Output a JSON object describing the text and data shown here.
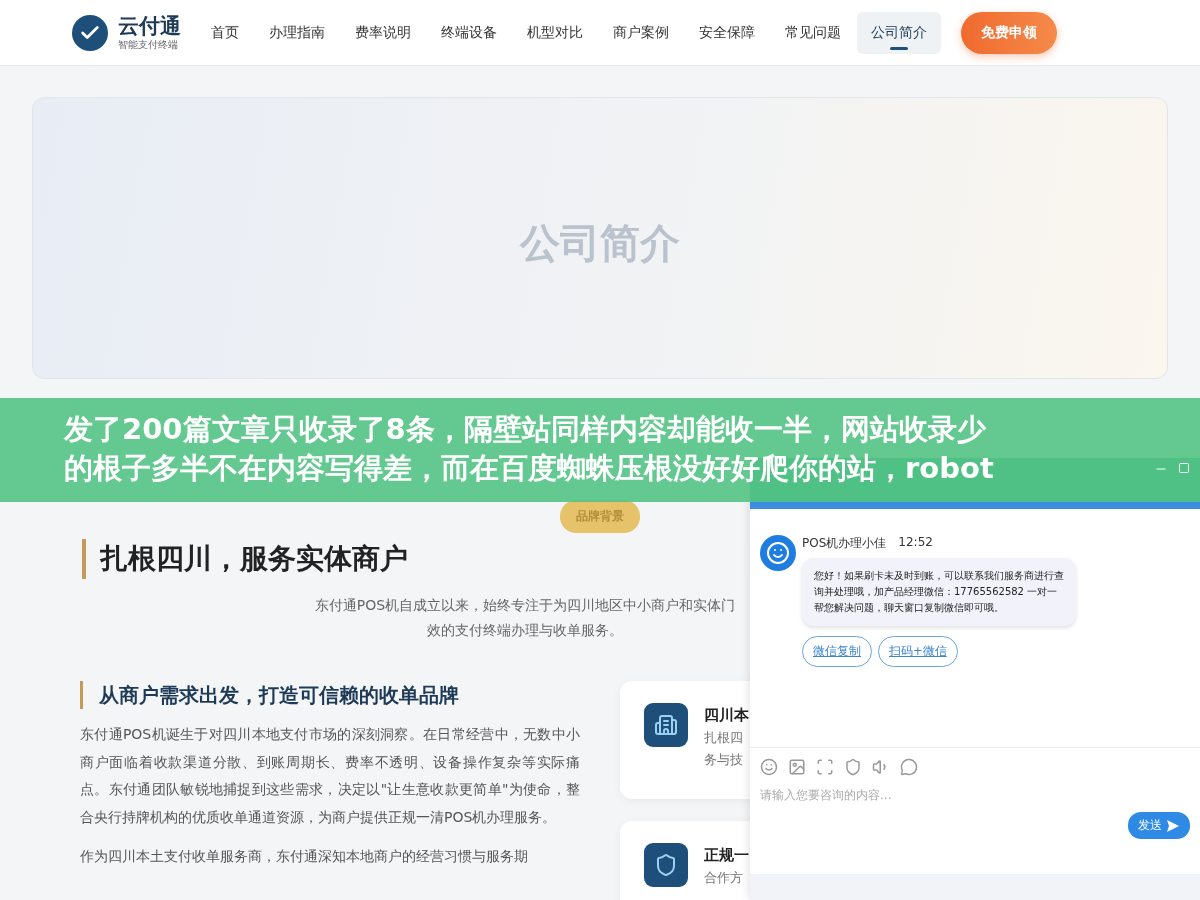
{
  "header": {
    "logo": {
      "name": "云付通",
      "tagline": "智能支付终端"
    },
    "nav": [
      {
        "label": "首页",
        "selected": false
      },
      {
        "label": "办理指南",
        "selected": false
      },
      {
        "label": "费率说明",
        "selected": false
      },
      {
        "label": "终端设备",
        "selected": false
      },
      {
        "label": "机型对比",
        "selected": false
      },
      {
        "label": "商户案例",
        "selected": false
      },
      {
        "label": "安全保障",
        "selected": false
      },
      {
        "label": "常见问题",
        "selected": false
      },
      {
        "label": "公司简介",
        "selected": true
      }
    ],
    "cta": "免费申领"
  },
  "hero": {
    "title": "公司简介"
  },
  "banner": {
    "lines": [
      "发了200篇文章只收录了8条，隔壁站同样内容却能收一半，网站收录少",
      "的根子多半不在内容写得差，而在百度蜘蛛压根没好好爬你的站，robot"
    ]
  },
  "section": {
    "badge": "品牌背景",
    "heading": "扎根四川，服务实体商户",
    "intro": [
      "东付通POS机自成立以来，始终专注于为四川地区中小商户和实体门",
      "效的支付终端办理与收单服务。"
    ],
    "subheading": "从商户需求出发，打造可信赖的收单品牌",
    "paragraphs": [
      "东付通POS机诞生于对四川本地支付市场的深刻洞察。在日常经营中，无数中小商户面临着收款渠道分散、到账周期长、费率不透明、设备操作复杂等实际痛点。东付通团队敏锐地捕捉到这些需求，决定以\"让生意收款更简单\"为使命，整合央行持牌机构的优质收单通道资源，为商户提供正规一清POS机办理服务。",
      "作为四川本土支付收单服务商，东付通深知本地商户的经营习惯与服务期"
    ],
    "cards": [
      {
        "kind": "building",
        "title": "四川本",
        "lines": [
          "扎根四",
          "务与技"
        ]
      },
      {
        "kind": "shield",
        "title": "正规一",
        "lines": [
          "合作方"
        ]
      }
    ]
  },
  "chat": {
    "agent": "POS机办理小佳",
    "time": "12:52",
    "message": "您好！如果刷卡未及时到账，可以联系我们服务商进行查询并处理哦，加产品经理微信：17765562582 一对一帮您解决问题，聊天窗口复制微信即可哦。",
    "actions": [
      "微信复制",
      "扫码+微信"
    ],
    "placeholder": "请输入您要咨询的内容...",
    "send": "发送"
  }
}
